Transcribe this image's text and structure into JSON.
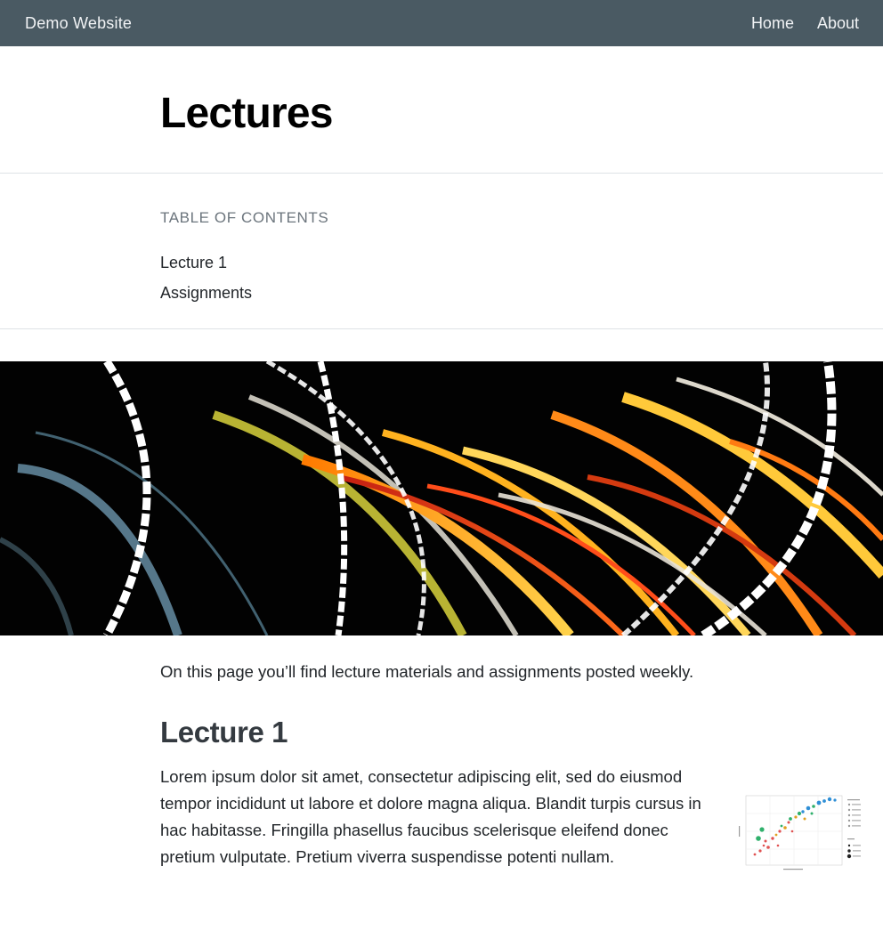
{
  "navbar": {
    "brand": "Demo Website",
    "links": [
      "Home",
      "About"
    ],
    "background": "#4a5a63"
  },
  "page": {
    "title": "Lectures"
  },
  "toc": {
    "heading": "TABLE OF CONTENTS",
    "items": [
      "Lecture 1",
      "Assignments"
    ]
  },
  "hero": {
    "icon": "light-trails-banner-image"
  },
  "content": {
    "intro": "On this page you’ll find lecture materials and assignments posted weekly.",
    "sections": [
      {
        "heading": "Lecture 1",
        "body": "Lorem ipsum dolor sit amet, consectetur adipiscing elit, sed do eiusmod tempor incididunt ut labore et dolore magna aliqua. Blandit turpis cursus in hac habitasse. Fringilla phasellus faucibus scelerisque eleifend donec pretium vulputate. Pretium viverra suspendisse potenti nullam."
      }
    ]
  },
  "figure": {
    "icon": "scatter-plot-thumbnail"
  }
}
